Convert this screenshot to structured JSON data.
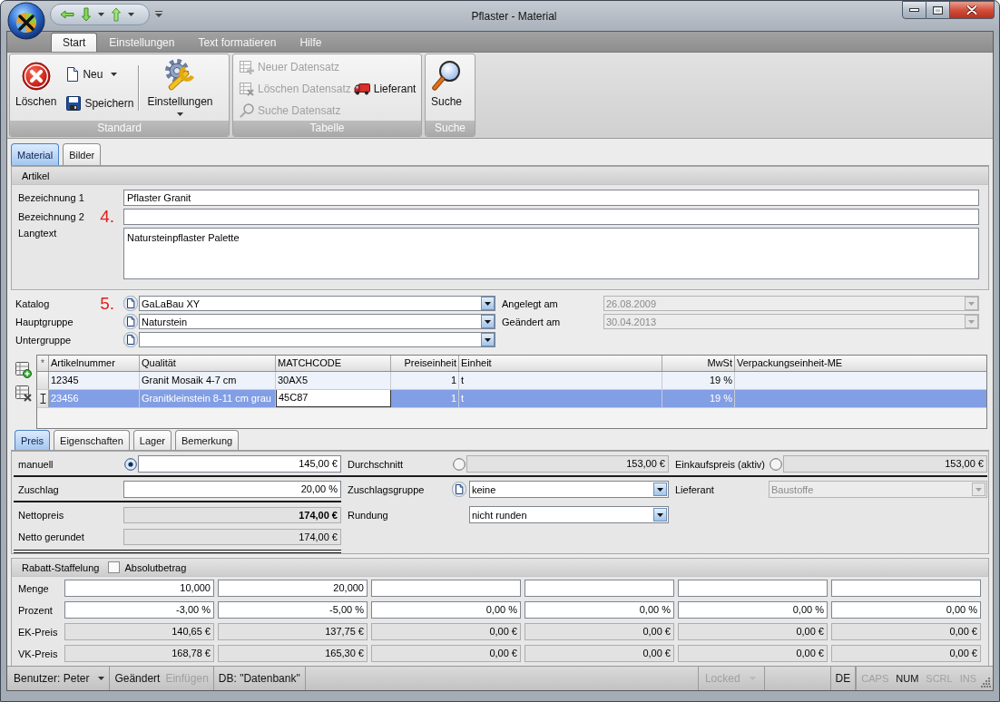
{
  "window": {
    "title": "Pflaster - Material"
  },
  "ribbon": {
    "tabs": [
      {
        "label": "Start",
        "selected": true
      },
      {
        "label": "Einstellungen",
        "selected": false
      },
      {
        "label": "Text formatieren",
        "selected": false
      },
      {
        "label": "Hilfe",
        "selected": false
      }
    ],
    "groups": [
      {
        "label": "Standard",
        "buttons": [
          {
            "label": "Löschen",
            "disabled": false
          },
          {
            "label": "Neu",
            "disabled": false
          },
          {
            "label": "Speichern",
            "disabled": false
          },
          {
            "label": "Einstellungen",
            "disabled": false
          }
        ]
      },
      {
        "label": "Tabelle",
        "buttons": [
          {
            "label": "Neuer Datensatz",
            "disabled": true
          },
          {
            "label": "Löschen Datensatz",
            "disabled": true
          },
          {
            "label": "Suche Datensatz",
            "disabled": true
          },
          {
            "label": "Lieferant",
            "disabled": false
          }
        ]
      },
      {
        "label": "Suche",
        "buttons": [
          {
            "label": "Suche",
            "disabled": false
          }
        ]
      }
    ]
  },
  "form_tabs": [
    {
      "label": "Material",
      "selected": true
    },
    {
      "label": "Bilder",
      "selected": false
    }
  ],
  "artikel": {
    "title": "Artikel",
    "fields": [
      {
        "kind": "text",
        "label": "Bezeichnung 1",
        "value": "Pflaster Granit"
      },
      {
        "kind": "text",
        "label": "Bezeichnung 2",
        "marker": "4."
      },
      {
        "kind": "multiline",
        "label": "Langtext",
        "value": "Natursteinpflaster Palette"
      }
    ]
  },
  "classification": {
    "fields": [
      {
        "label": "Katalog",
        "marker": "5.",
        "value": "GaLaBau XY"
      },
      {
        "label": "Hauptgruppe",
        "value": "Naturstein"
      },
      {
        "label": "Untergruppe"
      }
    ],
    "dates": [
      {
        "label": "Angelegt am",
        "value": "26.08.2009",
        "disabled": true
      },
      {
        "label": "Geändert am",
        "value": "30.04.2013",
        "disabled": true
      }
    ]
  },
  "table": {
    "corner": "*",
    "columns": [
      "Artikelnummer",
      "Qualität",
      "MATCHCODE",
      "Preiseinheit",
      "Einheit",
      "MwSt",
      "Verpackungseinheit-ME"
    ],
    "rows": [
      {
        "selected": false,
        "editing": false,
        "cells": [
          {
            "text": "12345",
            "editing": false
          },
          {
            "text": "Granit Mosaik 4-7 cm",
            "editing": false
          },
          {
            "text": "30AX5",
            "editing": false
          },
          {
            "text": "1",
            "editing": false
          },
          {
            "text": "t",
            "editing": false
          },
          {
            "text": "19 %",
            "editing": false
          },
          {
            "editing": false
          }
        ]
      },
      {
        "selected": true,
        "editing": true,
        "cells": [
          {
            "text": "23456",
            "editing": false
          },
          {
            "text": "Granitkleinstein 8-11 cm grau",
            "editing": false
          },
          {
            "text": "45C87",
            "editing": true
          },
          {
            "text": "1",
            "editing": false
          },
          {
            "text": "t",
            "editing": false
          },
          {
            "text": "19 %",
            "editing": false
          },
          {
            "editing": false
          }
        ]
      }
    ]
  },
  "detail_tabs": [
    {
      "label": "Preis",
      "selected": true
    },
    {
      "label": "Eigenschaften",
      "selected": false
    },
    {
      "label": "Lager",
      "selected": false
    },
    {
      "label": "Bemerkung",
      "selected": false
    }
  ],
  "pricing": {
    "sources": [
      {
        "label": "manuell",
        "value": "145,00 €",
        "selected": true,
        "disabled": false
      },
      {
        "label": "Durchschnitt",
        "value": "153,00 €",
        "selected": false,
        "disabled": true
      },
      {
        "label": "Einkaufspreis (aktiv)",
        "value": "153,00 €",
        "selected": false,
        "disabled": true
      }
    ],
    "zuschlag": {
      "label": "Zuschlag",
      "value": "20,00 %",
      "disabled": false
    },
    "zuschlagsgruppe": {
      "label": "Zuschlagsgruppe",
      "value": "keine",
      "disabled": false
    },
    "lieferant": {
      "label": "Lieferant",
      "value": "Baustoffe",
      "disabled": true
    },
    "nettopreis": {
      "label": "Nettopreis",
      "value": "174,00 €",
      "disabled": true
    },
    "rundung": {
      "label": "Rundung",
      "value": "nicht runden",
      "disabled": false
    },
    "netto_gerundet": {
      "label": "Netto gerundet",
      "value": "174,00 €",
      "disabled": true
    }
  },
  "discounts": {
    "title": "Rabatt-Staffelung",
    "absolute": {
      "label": "Absolutbetrag",
      "checked": false
    },
    "rows": [
      {
        "label": "Menge",
        "disabled": false,
        "values": [
          "10,000",
          "20,000"
        ]
      },
      {
        "label": "Prozent",
        "disabled": false,
        "values": [
          "-3,00 %",
          "-5,00 %",
          "0,00 %",
          "0,00 %",
          "0,00 %",
          "0,00 %"
        ]
      },
      {
        "label": "EK-Preis",
        "disabled": true,
        "values": [
          "140,65 €",
          "137,75 €",
          "0,00 €",
          "0,00 €",
          "0,00 €",
          "0,00 €"
        ]
      },
      {
        "label": "VK-Preis",
        "disabled": true,
        "values": [
          "168,78 €",
          "165,30 €",
          "0,00 €",
          "0,00 €",
          "0,00 €",
          "0,00 €"
        ]
      }
    ]
  },
  "status_bar": {
    "left": [
      {
        "items": [
          {
            "kind": "dropdown",
            "text": "Benutzer: Peter",
            "disabled": false
          }
        ]
      },
      {
        "items": [
          {
            "kind": "label",
            "text": "Geändert",
            "disabled": false
          },
          {
            "kind": "label",
            "text": "Einfügen",
            "disabled": true
          }
        ]
      },
      {
        "items": [
          {
            "kind": "label",
            "text": "DB: \"Datenbank\"",
            "disabled": false
          }
        ]
      }
    ],
    "right": [
      {
        "items": [
          {
            "kind": "dropdown",
            "text": "Locked",
            "disabled": true
          }
        ]
      },
      {
        "items": [
          {
            "kind": "label",
            "text": "DE",
            "disabled": false
          }
        ]
      },
      {
        "items": [
          {
            "kind": "key",
            "text": "CAPS",
            "disabled": true
          },
          {
            "kind": "key",
            "text": "NUM",
            "disabled": false
          },
          {
            "kind": "key",
            "text": "SCRL",
            "disabled": true
          },
          {
            "kind": "key",
            "text": "INS",
            "disabled": true
          }
        ]
      }
    ]
  }
}
